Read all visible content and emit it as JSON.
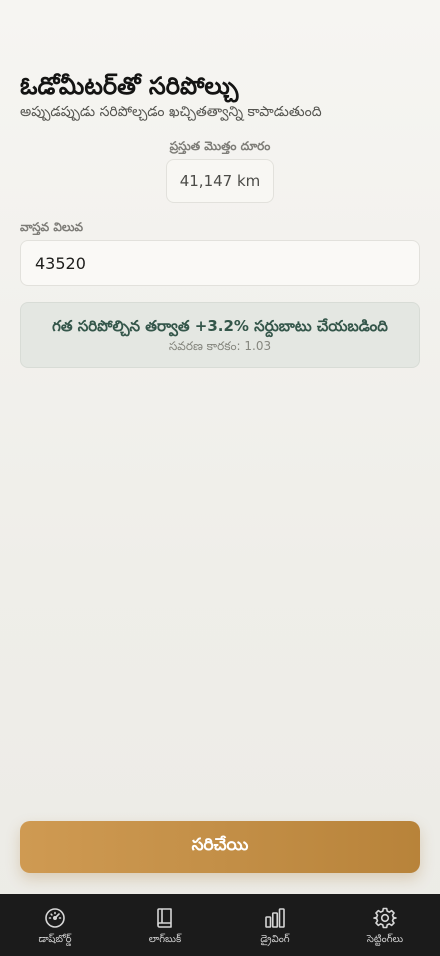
{
  "header": {
    "title": "ఓడోమీటర్‌తో సరిపోల్చు",
    "subtitle": "అప్పుడప్పుడు సరిపోల్చడం ఖచ్చితత్వాన్ని కాపాడుతుంది"
  },
  "current_distance": {
    "label": "ప్రస్తుత మొత్తం దూరం",
    "value": "41,147 km"
  },
  "actual_value": {
    "label": "వాస్తవ విలువ",
    "value": "43520",
    "placeholder": ""
  },
  "calibration_info": {
    "message": "గత సరిపోల్చిన తర్వాత +3.2% సర్దుబాటు చేయబడింది",
    "factor": "సవరణ కారకం: 1.03"
  },
  "confirm_button": {
    "label": "సరిచేయి"
  },
  "colors": {
    "accent": "#c38f47",
    "info_text": "#34564a",
    "tab_bar_bg": "#1b1b1b"
  },
  "tab_bar": {
    "items": [
      {
        "label": "డాష్‌బోర్డ్",
        "icon": "speedometer-icon"
      },
      {
        "label": "లాగ్‌బుక్",
        "icon": "book-icon"
      },
      {
        "label": "డ్రైవింగ్",
        "icon": "bar-chart-icon"
      },
      {
        "label": "సెట్టింగ్‌లు",
        "icon": "gear-icon"
      }
    ]
  }
}
